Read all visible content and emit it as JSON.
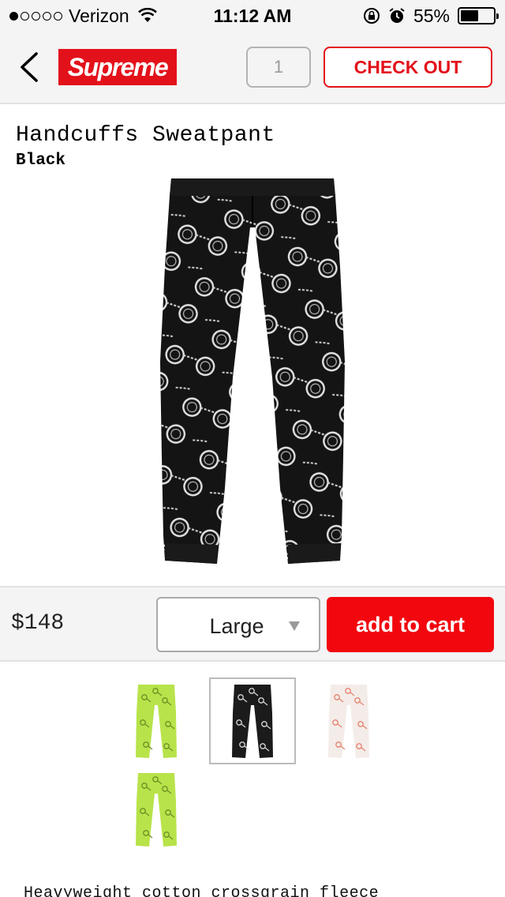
{
  "status_bar": {
    "carrier": "Verizon",
    "time": "11:12 AM",
    "battery_percent": "55%",
    "battery_level": 0.55,
    "signal_bars": 1
  },
  "nav": {
    "logo_text": "Supreme",
    "cart_quantity": "1",
    "checkout_label": "CHECK OUT"
  },
  "product": {
    "name": "Handcuffs Sweatpant",
    "color": "Black",
    "price": "$148",
    "selected_size": "Large",
    "add_to_cart_label": "add to cart",
    "description": "Heavyweight cotton crossgrain fleece"
  },
  "swatches": [
    {
      "color": "Lime",
      "fill": "#b8e34a",
      "print": "#6f8f24",
      "selected": false
    },
    {
      "color": "Black",
      "fill": "#1b1b1b",
      "print": "#d8d8d8",
      "selected": true
    },
    {
      "color": "White",
      "fill": "#f4ece8",
      "print": "#e4826e",
      "selected": false
    },
    {
      "color": "Lime",
      "fill": "#b8e34a",
      "print": "#6f8f24",
      "selected": false
    }
  ],
  "colors": {
    "brand_red": "#e3111a",
    "cta_red": "#f2070e"
  }
}
